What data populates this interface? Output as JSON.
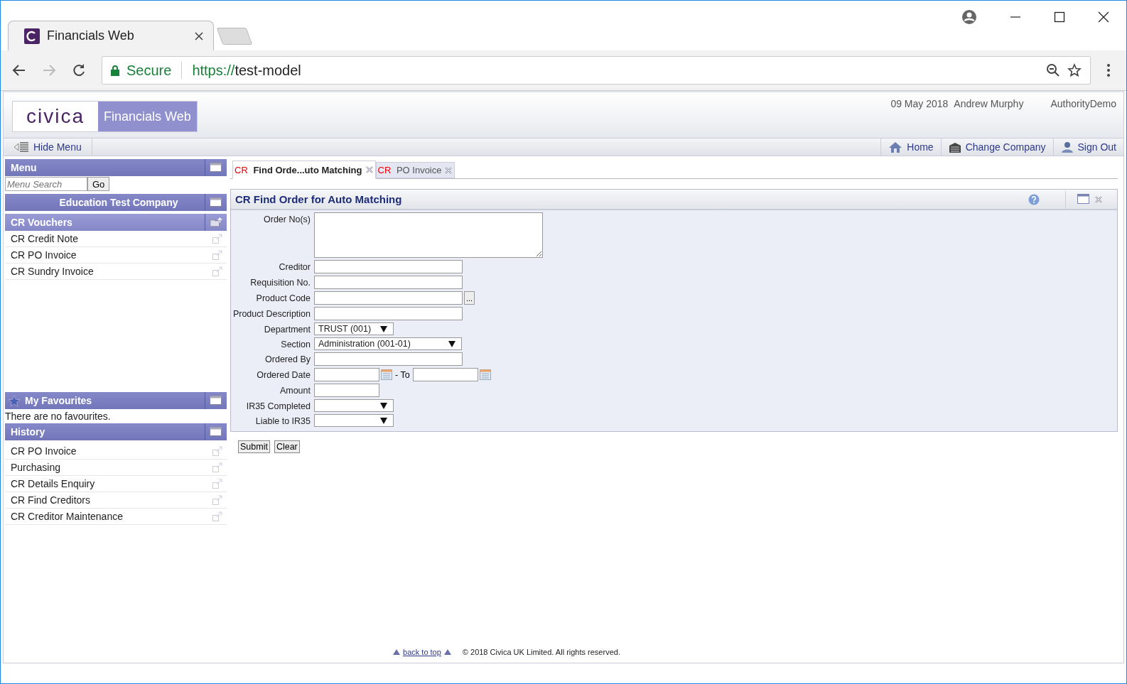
{
  "browser": {
    "tab_title": "Financials Web",
    "secure": "Secure",
    "url_scheme": "https://",
    "url_host": "test-model"
  },
  "header": {
    "logo": "civica",
    "product": "Financials Web",
    "date": "09 May 2018",
    "user": "Andrew Murphy",
    "company": "AuthorityDemo"
  },
  "toolbar": {
    "hide_menu": "Hide Menu",
    "links": [
      {
        "label": "Home",
        "kind": "home"
      },
      {
        "label": "Change Company",
        "kind": "company"
      },
      {
        "label": "Sign Out",
        "kind": "signout"
      }
    ]
  },
  "sidebar": {
    "menu_title": "Menu",
    "search_placeholder": "Menu Search",
    "go": "Go",
    "company": "Education Test Company",
    "section": "CR Vouchers",
    "items": [
      "CR Credit Note",
      "CR PO Invoice",
      "CR Sundry Invoice"
    ],
    "favourites_title": "My Favourites",
    "favourites_empty": "There are no favourites.",
    "history_title": "History",
    "history": [
      "CR PO Invoice",
      "Purchasing",
      "CR Details Enquiry",
      "CR Find Creditors",
      "CR Creditor Maintenance"
    ]
  },
  "tabs": [
    {
      "prefix": "CR",
      "label": "Find Orde...uto Matching",
      "selected": true
    },
    {
      "prefix": "CR",
      "label": "PO Invoice",
      "selected": false
    }
  ],
  "form": {
    "title": "CR Find Order for Auto Matching",
    "fields": [
      {
        "label": "Order No(s)",
        "kind": "textarea"
      },
      {
        "label": "Creditor",
        "kind": "text"
      },
      {
        "label": "Requisition No.",
        "kind": "text"
      },
      {
        "label": "Product Code",
        "kind": "lookup",
        "button": "..."
      },
      {
        "label": "Product Description",
        "kind": "text"
      },
      {
        "label": "Department",
        "kind": "select",
        "value": "TRUST (001)"
      },
      {
        "label": "Section",
        "kind": "select-wide",
        "value": "Administration (001-01)"
      },
      {
        "label": "Ordered By",
        "kind": "text"
      },
      {
        "label": "Ordered Date",
        "kind": "daterange",
        "to_label": "- To"
      },
      {
        "label": "Amount",
        "kind": "short"
      },
      {
        "label": "IR35 Completed",
        "kind": "select"
      },
      {
        "label": "Liable to IR35",
        "kind": "select"
      }
    ]
  },
  "buttons": [
    "Submit",
    "Clear"
  ],
  "footer": {
    "back_to_top": "back to top",
    "copyright": "© 2018 Civica UK Limited. All rights reserved."
  }
}
